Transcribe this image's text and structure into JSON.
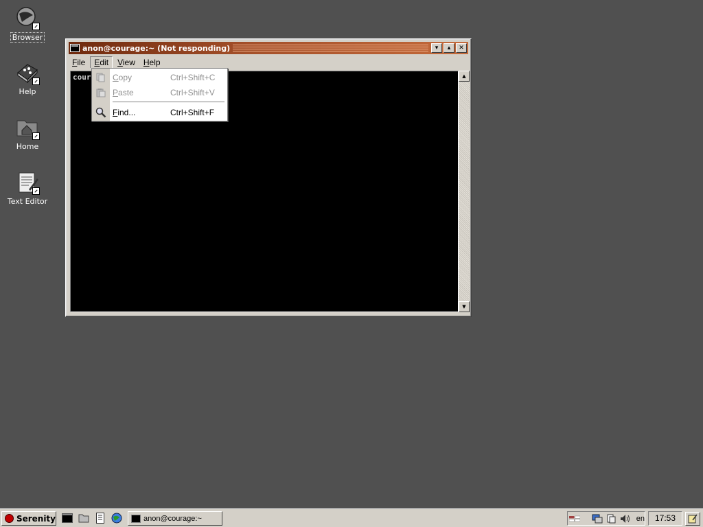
{
  "desktop": {
    "icons": [
      {
        "label": "Browser",
        "icon": "browser-globe-icon"
      },
      {
        "label": "Help",
        "icon": "help-book-icon"
      },
      {
        "label": "Home",
        "icon": "home-folder-icon"
      },
      {
        "label": "Text Editor",
        "icon": "text-editor-icon"
      }
    ]
  },
  "window": {
    "title": "anon@courage:~ (Not responding)",
    "buttons": {
      "minimize": "▾",
      "maximize": "▴",
      "close": "✕"
    },
    "menu": {
      "file": {
        "ul": "F",
        "rest": "ile"
      },
      "edit": {
        "ul": "E",
        "rest": "dit"
      },
      "view": {
        "ul": "V",
        "rest": "iew"
      },
      "help": {
        "ul": "H",
        "rest": "elp"
      }
    },
    "terminal_text": "cour",
    "scroll": {
      "up": "▲",
      "down": "▼"
    }
  },
  "edit_menu": {
    "items": [
      {
        "ul": "C",
        "rest": "opy",
        "shortcut": "Ctrl+Shift+C",
        "enabled": false,
        "icon": "copy-icon"
      },
      {
        "ul": "P",
        "rest": "aste",
        "shortcut": "Ctrl+Shift+V",
        "enabled": false,
        "icon": "paste-icon"
      },
      {
        "ul": "F",
        "rest": "ind...",
        "shortcut": "Ctrl+Shift+F",
        "enabled": true,
        "icon": "search-icon"
      }
    ]
  },
  "taskbar": {
    "start_label": "Serenity",
    "quick_launch": [
      "terminal-icon",
      "file-manager-icon",
      "text-editor-icon",
      "browser-icon"
    ],
    "task_label": "anon@courage:~",
    "tray_lang": "en",
    "clock": "17:53"
  },
  "colors": {
    "desktop": "#505050",
    "title_active": "#a4502a",
    "face": "#d4d0c8"
  }
}
